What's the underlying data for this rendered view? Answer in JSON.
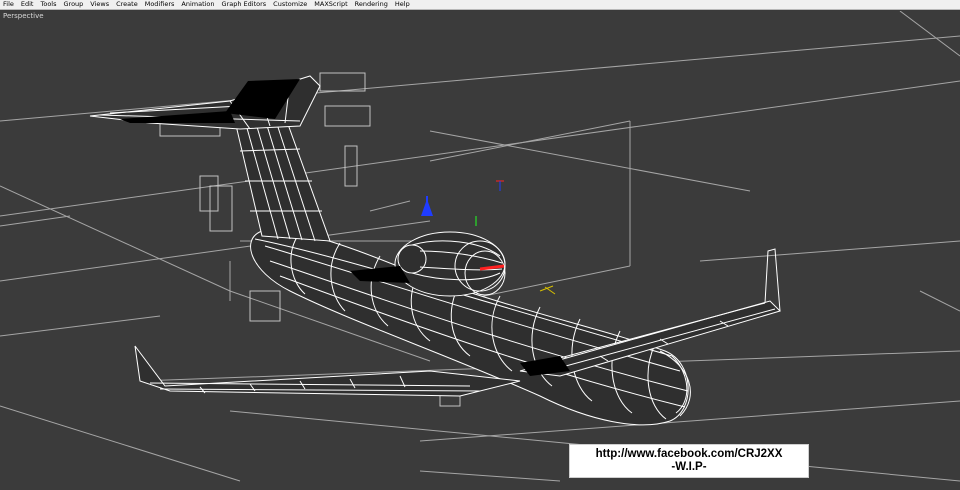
{
  "menu": {
    "items": [
      "File",
      "Edit",
      "Tools",
      "Group",
      "Views",
      "Create",
      "Modifiers",
      "Animation",
      "Graph Editors",
      "Customize",
      "MAXScript",
      "Rendering",
      "Help"
    ]
  },
  "viewport": {
    "label": "Perspective",
    "background_color": "#3b3b3b",
    "grid_color": "#bdbdbd",
    "wire_color": "#ffffff",
    "gizmo": {
      "z_axis_color": "#1f3cff",
      "x_axis_color": "#ff2020",
      "y_axis_color": "#2bbf2b"
    }
  },
  "caption": {
    "url": "http://www.facebook.com/CRJ2XX",
    "status": "-W.I.P-"
  },
  "icons": [
    "transform-gizmo-icon"
  ]
}
